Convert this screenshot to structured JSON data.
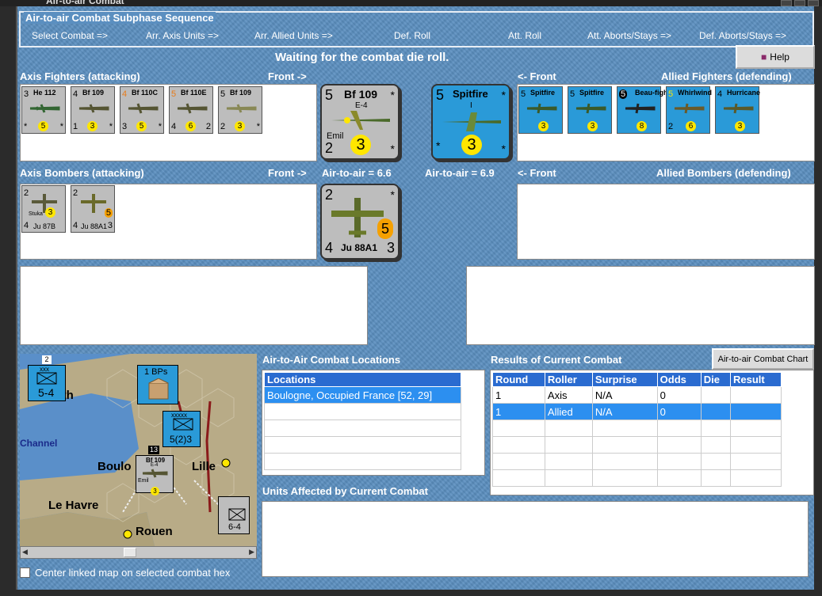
{
  "window": {
    "title": "Air-to-air Combat"
  },
  "sequence": {
    "title": "Air-to-air Combat Subphase Sequence",
    "steps": [
      "Select Combat =>",
      "Arr. Axis Units =>",
      "Arr. Allied Units =>",
      "Def. Roll",
      "Att. Roll",
      "Att. Aborts/Stays =>",
      "Def. Aborts/Stays =>"
    ]
  },
  "status": "Waiting for the combat die roll.",
  "help_label": "Help",
  "labels": {
    "axis_fighters": "Axis Fighters (attacking)",
    "front_right": "Front ->",
    "front_left": "<- Front",
    "allied_fighters": "Allied Fighters (defending)",
    "axis_bombers": "Axis Bombers (attacking)",
    "allied_bombers": "Allied Bombers (defending)",
    "axis_a2a": "Air-to-air = 6.6",
    "allied_a2a": "Air-to-air = 6.9"
  },
  "axis_fighters": [
    {
      "top": "3",
      "name": "He 112",
      "bottom": "5",
      "left": "*",
      "right": "*"
    },
    {
      "top": "4",
      "name": "Bf 109",
      "sub": "E-1",
      "tag": "Emil",
      "bottom": "3",
      "left": "1",
      "right": "*"
    },
    {
      "top": "4",
      "name": "Bf 110C",
      "sub": "1",
      "bottom": "5",
      "left": "3",
      "right": "*"
    },
    {
      "top": "5",
      "name": "Bf 110E",
      "sub": "1",
      "bottom": "6",
      "left": "4",
      "right": "2"
    },
    {
      "top": "5",
      "name": "Bf 109",
      "sub": "E-4",
      "tag": "Emil",
      "bottom": "3",
      "left": "2",
      "right": "*"
    }
  ],
  "axis_big_fighter": {
    "top": "5",
    "name": "Bf 109",
    "sub": "E-4",
    "tag": "Emil",
    "left": "2",
    "dot": "3",
    "star": "*"
  },
  "allied_big_fighter": {
    "top": "5",
    "name": "Spitfire",
    "sub": "I",
    "dot": "3",
    "star": "*"
  },
  "allied_fighters": [
    {
      "top": "5",
      "name": "Spitfire",
      "sub": "I",
      "bottom": "3"
    },
    {
      "top": "5",
      "name": "Spitfire",
      "sub": "I",
      "bottom": "3"
    },
    {
      "top": "5",
      "name": "Beau-fighter",
      "sub": "Mk. I",
      "bottom": "8"
    },
    {
      "top": "5",
      "name": "Whirlwind",
      "sub": "",
      "bottom": "6",
      "left": "2"
    },
    {
      "top": "4",
      "name": "Hurricane",
      "sub": "I",
      "bottom": "3"
    }
  ],
  "axis_bombers": [
    {
      "top": "2",
      "name": "Ju 87B",
      "tag": "Stuka",
      "bottom": "3",
      "left": "4"
    },
    {
      "top": "2",
      "name": "Ju 88A1",
      "bottom": "5",
      "left": "4",
      "right": "3"
    }
  ],
  "axis_big_bomber": {
    "top": "2",
    "name": "Ju 88A1",
    "left": "4",
    "right": "3",
    "dot": "5",
    "star": "*"
  },
  "locations": {
    "title": "Air-to-Air Combat Locations",
    "header": "Locations",
    "rows": [
      "Boulogne, Occupied France [52, 29]",
      "",
      "",
      "",
      "",
      ""
    ]
  },
  "results": {
    "title": "Results of Current Combat",
    "chart_button": "Air-to-air Combat Chart",
    "headers": [
      "Round",
      "Roller",
      "Surprise",
      "Odds",
      "Die",
      "Result"
    ],
    "rows": [
      [
        "1",
        "Axis",
        "N/A",
        "0",
        "",
        ""
      ],
      [
        "1",
        "Allied",
        "N/A",
        "0",
        "",
        ""
      ],
      [
        "",
        "",
        "",
        "",
        "",
        ""
      ],
      [
        "",
        "",
        "",
        "",
        "",
        ""
      ],
      [
        "",
        "",
        "",
        "",
        "",
        ""
      ],
      [
        "",
        "",
        "",
        "",
        "",
        ""
      ]
    ]
  },
  "affected": {
    "title": "Units Affected by Current Combat"
  },
  "map": {
    "labels": [
      "mouth",
      "Channel",
      "Boulo",
      "Lille",
      "Le Havre",
      "Rouen"
    ],
    "bp": "1 BPs",
    "unit1": "5-4",
    "unit2": "5(2)3",
    "unit3": "6-4",
    "counter_name": "Bf 109",
    "counter_sub": "E-4",
    "counter_tag": "Emil",
    "counter_dot": "3",
    "xxx": "xxx",
    "xxxxx": "xxxxx",
    "num13": "13",
    "num2": "2"
  },
  "center_checkbox": "Center linked map on selected combat hex"
}
